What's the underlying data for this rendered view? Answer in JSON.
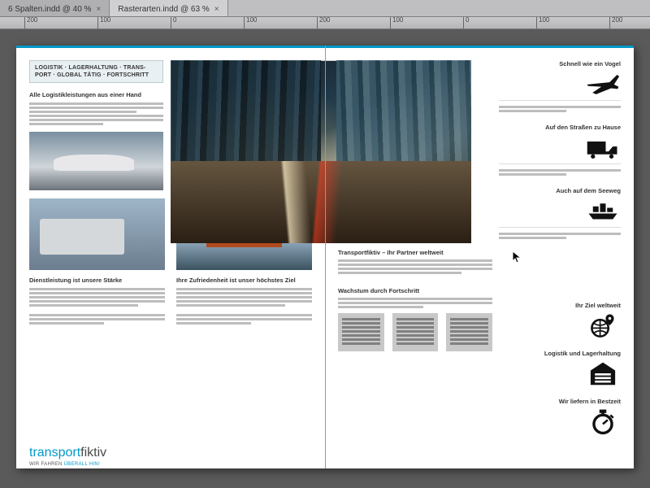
{
  "tabs": [
    {
      "label": "6 Spalten.indd @ 40 %",
      "active": false
    },
    {
      "label": "Rasterarten.indd @ 63 %",
      "active": true
    }
  ],
  "ruler_labels_top": [
    "200",
    "100",
    "0",
    "100",
    "200",
    "100",
    "0",
    "100",
    "200"
  ],
  "documents": {
    "kicker": "LOGISTIK · LAGERHALTUNG · TRANS­PORT · GLOBAL TÄTIG · FORTSCHRITT",
    "left": {
      "h1": "Alle Logistikleistungen aus einer Hand",
      "h2": "Dienstleistung ist unsere Stärke",
      "h3": "Ihre Zufriedenheit ist unser höchstes Ziel"
    },
    "right": {
      "h1": "Transportfiktiv – Ihr Partner weltweit",
      "h2": "Wachstum durch Fortschritt"
    },
    "sidebar_top": [
      {
        "heading": "Schnell wie ein Vogel",
        "icon": "plane-icon"
      },
      {
        "heading": "Auf den Straßen zu Hause",
        "icon": "truck-icon"
      },
      {
        "heading": "Auch auf dem Seeweg",
        "icon": "ship-icon"
      }
    ],
    "sidebar_bottom": [
      {
        "heading": "Ihr Ziel weltweit",
        "icon": "globe-pin-icon"
      },
      {
        "heading": "Logistik und Lagerhaltung",
        "icon": "warehouse-icon"
      },
      {
        "heading": "Wir liefern in Bestzeit",
        "icon": "stopwatch-icon"
      }
    ],
    "logo": {
      "brand_a": "transport",
      "brand_b": "fiktiv",
      "tagline_a": "WIR FAHREN ",
      "tagline_b": "ÜBERALL HIN!"
    }
  }
}
